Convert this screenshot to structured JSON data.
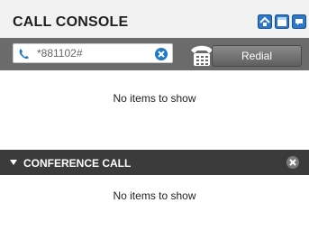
{
  "header": {
    "title": "CALL CONSOLE",
    "icons": [
      "home-up-icon",
      "window-icon",
      "chat-icon"
    ]
  },
  "toolbar": {
    "phone_input_value": "*881102#",
    "redial_label": "Redial",
    "accent": "#1f7ac6"
  },
  "calls": {
    "empty_text": "No items to show"
  },
  "conference": {
    "title": "CONFERENCE CALL",
    "empty_text": "No items to show"
  }
}
